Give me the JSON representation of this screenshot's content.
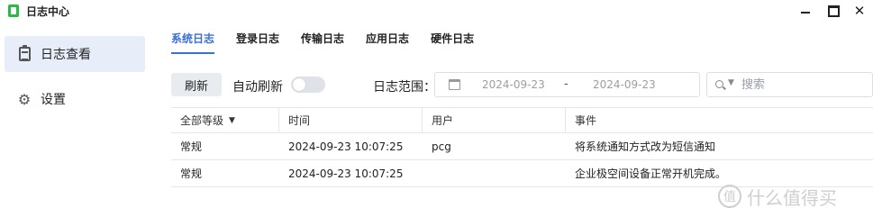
{
  "window": {
    "title": "日志中心",
    "controls": {
      "minimize": "minimize-icon",
      "maximize": "maximize-icon",
      "close": "✕"
    }
  },
  "sidebar": {
    "items": [
      {
        "label": "日志查看",
        "icon": "clipboard-icon",
        "active": true
      },
      {
        "label": "设置",
        "icon": "gear-icon",
        "active": false
      }
    ]
  },
  "tabs": [
    {
      "label": "系统日志",
      "active": true
    },
    {
      "label": "登录日志",
      "active": false
    },
    {
      "label": "传输日志",
      "active": false
    },
    {
      "label": "应用日志",
      "active": false
    },
    {
      "label": "硬件日志",
      "active": false
    }
  ],
  "toolbar": {
    "refresh_label": "刷新",
    "auto_refresh_label": "自动刷新",
    "auto_refresh_on": false,
    "range_label": "日志范围：",
    "date_start": "2024-09-23",
    "date_separator": "-",
    "date_end": "2024-09-23",
    "search_placeholder": "搜索"
  },
  "table": {
    "columns": [
      "全部等级",
      "时间",
      "用户",
      "事件"
    ],
    "rows": [
      {
        "level": "常规",
        "time": "2024-09-23 10:07:25",
        "user": "pcg",
        "event": "将系统通知方式改为短信通知"
      },
      {
        "level": "常规",
        "time": "2024-09-23 10:07:25",
        "user": "",
        "event": "企业极空间设备正常开机完成。"
      }
    ]
  },
  "watermark": {
    "text": "什么值得买",
    "logo_glyph": "值"
  },
  "colors": {
    "accent": "#3a6fd8",
    "sidebar_active": "#e8eef9",
    "app_icon": "#2db84a"
  }
}
